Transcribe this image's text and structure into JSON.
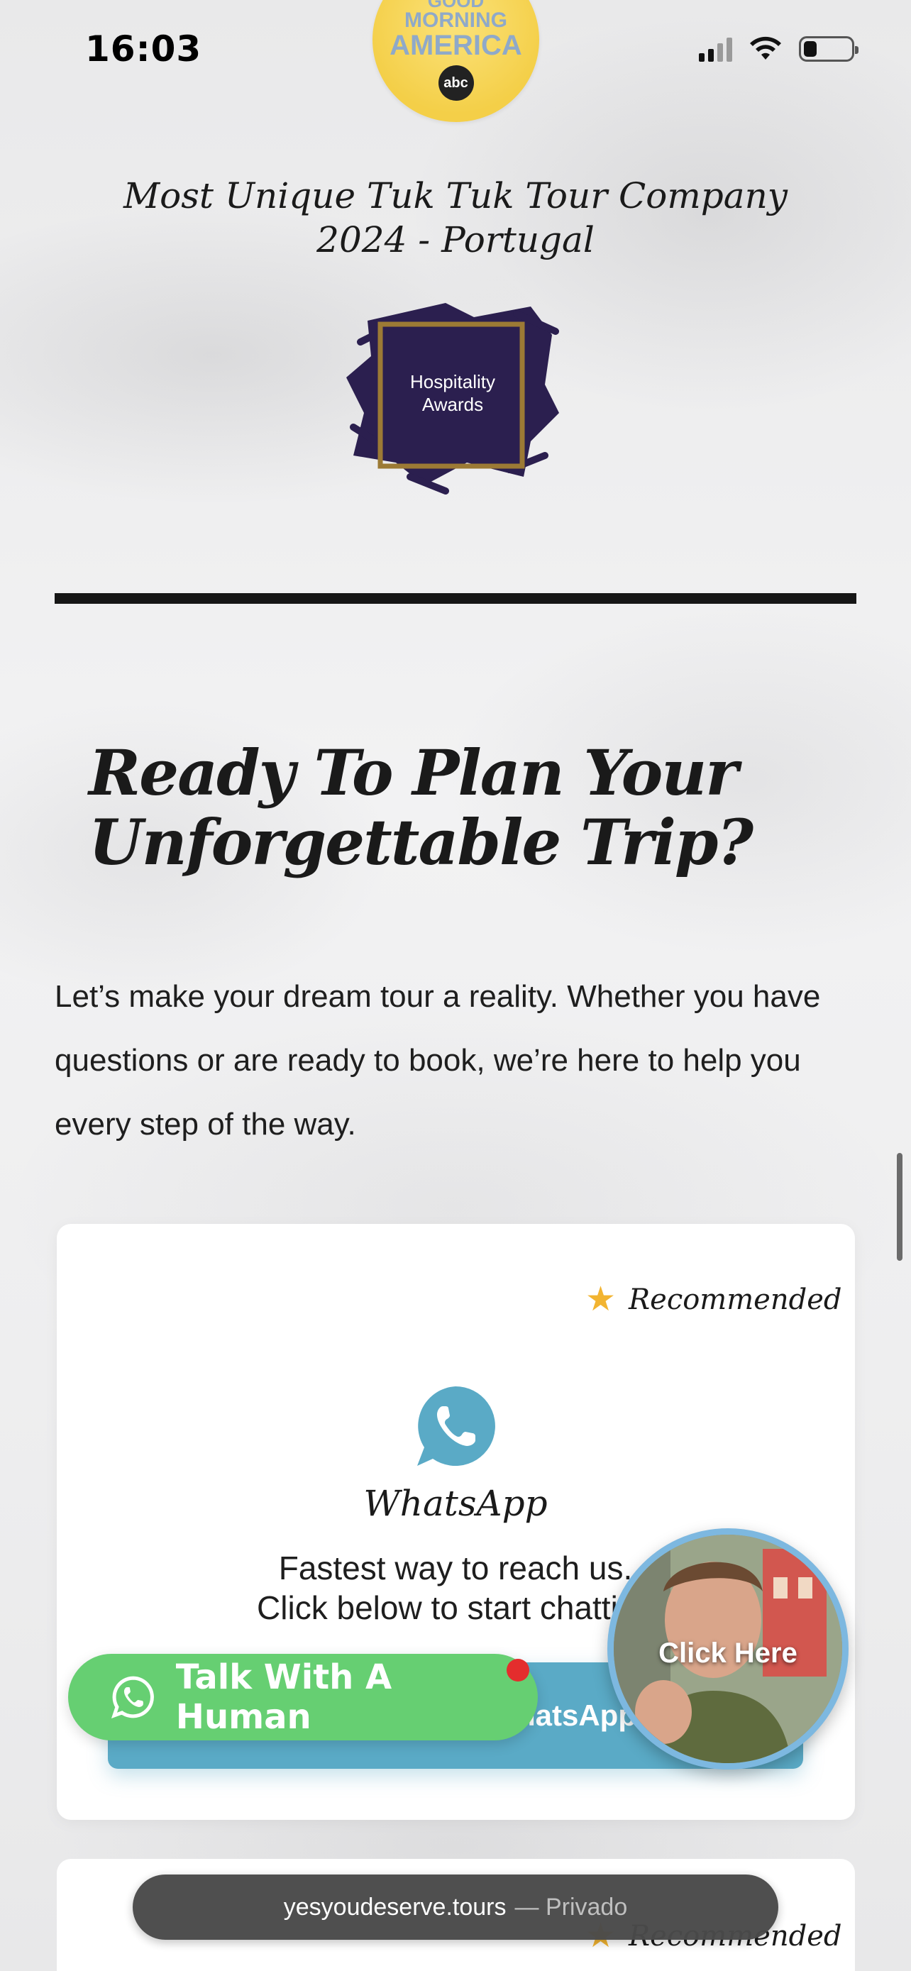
{
  "status_bar": {
    "time": "16:03"
  },
  "gma_badge": {
    "line1": "GOOD",
    "line2": "MORNING",
    "line3": "AMERICA",
    "network": "abc"
  },
  "award": {
    "title_line1": "Most Unique Tuk Tuk Tour Company",
    "title_line2": "2024 - Portugal",
    "badge_line1": "Hospitality",
    "badge_line2": "Awards"
  },
  "cta": {
    "heading_line1": "Ready To Plan Your",
    "heading_line2": "Unforgettable Trip?",
    "body": "Let’s make your dream tour a reality. Whether you have questions or are ready to book, we’re here to help you every step of the way."
  },
  "whatsapp_card": {
    "recommended_label": "Recommended",
    "title": "WhatsApp",
    "desc_line1": "Fastest way to reach us.",
    "desc_line2": "Click below to start chatting",
    "button_label": "WhatsApp"
  },
  "second_card": {
    "recommended_label": "Recommended"
  },
  "floating": {
    "talk_human_label": "Talk With A Human",
    "video_label": "Click Here"
  },
  "browser": {
    "domain": "yesyoudeserve.tours",
    "mode": "— Privado"
  },
  "colors": {
    "whatsapp_teal": "#5aaac6",
    "talk_green": "#66cf72",
    "star": "#f2b431",
    "badge_purple": "#2b1f4f",
    "badge_gold": "#9c7a35"
  }
}
